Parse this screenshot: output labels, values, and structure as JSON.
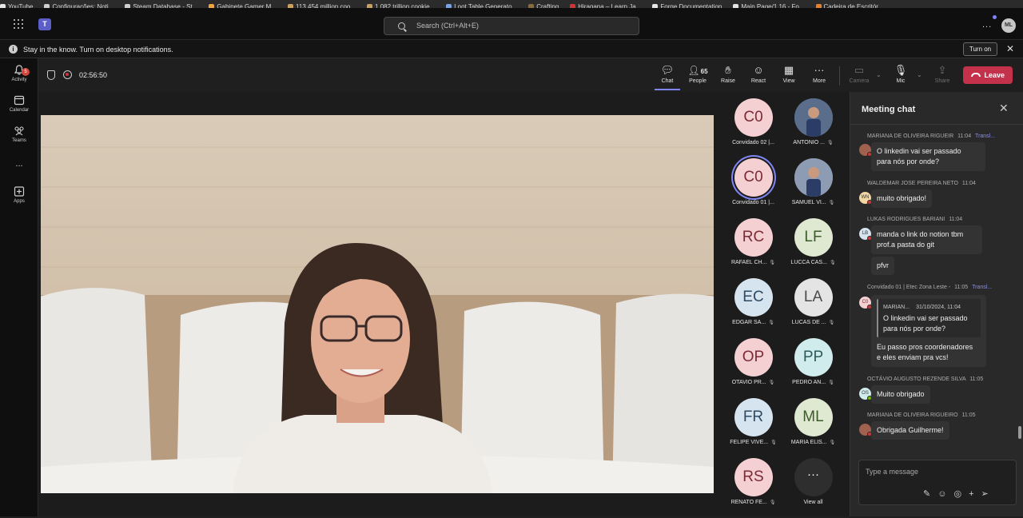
{
  "bookmarks": [
    {
      "label": "YouTube",
      "color": "#e5e5e5"
    },
    {
      "label": "Configurações: Noti...",
      "color": "#cfcfcf"
    },
    {
      "label": "Steam Database - St...",
      "color": "#cfcfcf"
    },
    {
      "label": "Gabinete Gamer M...",
      "color": "#f2a33a"
    },
    {
      "label": "113.454 million coo...",
      "color": "#c8a060"
    },
    {
      "label": "1.082 trillion cookie...",
      "color": "#c8a060"
    },
    {
      "label": "Loot Table Generato...",
      "color": "#7aa2e0"
    },
    {
      "label": "Crafting",
      "color": "#8a6a3a"
    },
    {
      "label": "Hiragana – Learn Ja...",
      "color": "#d13438"
    },
    {
      "label": "Forge Documentation",
      "color": "#e5e5e5"
    },
    {
      "label": "Main Page/1.16 - Fo...",
      "color": "#e5e5e5"
    },
    {
      "label": "Cadeira de Escritór...",
      "color": "#e8822a"
    }
  ],
  "topbar": {
    "search_placeholder": "Search (Ctrl+Alt+E)",
    "avatar_initials": "ML",
    "more_label": "..."
  },
  "notification": {
    "message": "Stay in the know. Turn on desktop notifications.",
    "turn_on_label": "Turn on"
  },
  "rail": {
    "activity": "Activity",
    "activity_badge": "5",
    "calendar": "Calendar",
    "teams": "Teams",
    "more": "...",
    "apps": "Apps"
  },
  "call": {
    "timer": "02:56:50",
    "participants_count": "65",
    "controls": {
      "chat": "Chat",
      "people": "People",
      "raise": "Raise",
      "react": "React",
      "view": "View",
      "more": "More",
      "camera": "Camera",
      "mic": "Mic",
      "share": "Share",
      "leave": "Leave"
    }
  },
  "gallery": [
    {
      "initials": "C0",
      "name": "Convidado 02 |...",
      "bg": "#f5d0d3",
      "fg": "#7a2b34",
      "photo": false,
      "muted": false
    },
    {
      "initials": "",
      "name": "ANTONIO ...",
      "bg": "#5a6e8c",
      "fg": "#fff",
      "photo": true,
      "muted": true
    },
    {
      "initials": "C0",
      "name": "Convidado 01 |...",
      "bg": "#f5d0d3",
      "fg": "#7a2b34",
      "photo": false,
      "muted": false,
      "selected": true
    },
    {
      "initials": "",
      "name": "SAMUEL VI...",
      "bg": "#8d9bb3",
      "fg": "#fff",
      "photo": true,
      "muted": true
    },
    {
      "initials": "RC",
      "name": "RAFAEL CH...",
      "bg": "#f5d0d3",
      "fg": "#7a2b34",
      "photo": false,
      "muted": true
    },
    {
      "initials": "LF",
      "name": "LUCCA CAS...",
      "bg": "#dfe8d0",
      "fg": "#3c5a2a",
      "photo": false,
      "muted": true
    },
    {
      "initials": "EC",
      "name": "EDGAR SA...",
      "bg": "#d6e4f0",
      "fg": "#2d4a64",
      "photo": false,
      "muted": true
    },
    {
      "initials": "LA",
      "name": "LUCAS DE ...",
      "bg": "#e4e4e4",
      "fg": "#4a4a4a",
      "photo": false,
      "muted": true
    },
    {
      "initials": "OP",
      "name": "OTAVIO PR...",
      "bg": "#f5d0d3",
      "fg": "#7a2b34",
      "photo": false,
      "muted": true
    },
    {
      "initials": "PP",
      "name": "PEDRO AN...",
      "bg": "#d0ecec",
      "fg": "#2a5c5c",
      "photo": false,
      "muted": true
    },
    {
      "initials": "FR",
      "name": "FELIPE VIVE...",
      "bg": "#d6e4f0",
      "fg": "#2d4a64",
      "photo": false,
      "muted": true
    },
    {
      "initials": "ML",
      "name": "MARIA ELIS...",
      "bg": "#dfe8d0",
      "fg": "#3c5a2a",
      "photo": false,
      "muted": true
    },
    {
      "initials": "RS",
      "name": "RENATO FE...",
      "bg": "#f5d0d3",
      "fg": "#7a2b34",
      "photo": false,
      "muted": true
    }
  ],
  "gallery_view_all": {
    "label": "View all",
    "glyph": "···"
  },
  "chat": {
    "title": "Meeting chat",
    "messages": [
      {
        "sender": "MARIANA DE OLIVEIRA RIGUEIR",
        "time": "11:04",
        "translate": "Transl...",
        "text_lines": [
          "O linkedin vai ser passado",
          "para nós por onde?"
        ],
        "avatar": ""
      },
      {
        "sender": "WALDEMAR JOSE PEREIRA NETO",
        "time": "11:04",
        "text_lines": [
          "muito obrigado!"
        ],
        "avatar": "WN"
      },
      {
        "sender": "LUKAS RODRIGUES BARIANI",
        "time": "11:04",
        "text_lines": [
          "manda o link do notion tbm",
          "prof.a pasta do git"
        ],
        "text2": "pfvr",
        "avatar": "LB"
      },
      {
        "sender": "Convidado 01 | Etec Zona Leste -",
        "time": "11:05",
        "translate": "Transl...",
        "quote_author": "MARIAN...",
        "quote_time": "31/10/2024, 11:04",
        "quote_lines": [
          "O linkedin vai ser passado",
          "para nós por onde?"
        ],
        "text_lines": [
          "Eu passo pros coordenadores",
          "e eles enviam pra vcs!"
        ],
        "avatar": "C0"
      },
      {
        "sender": "OCTÁVIO AUGUSTO REZENDE SILVA",
        "time": "11:05",
        "text_lines": [
          "Muito obrigado"
        ],
        "avatar": "OS"
      },
      {
        "sender": "MARIANA DE OLIVEIRA RIGUEIRO",
        "time": "11:05",
        "text_lines": [
          "Obrigada Guilherme!"
        ],
        "avatar": ""
      }
    ],
    "composer_placeholder": "Type a message"
  },
  "colors": {
    "accent": "#7f85f5",
    "leave": "#c4314b",
    "status_busy": "#d13438"
  }
}
